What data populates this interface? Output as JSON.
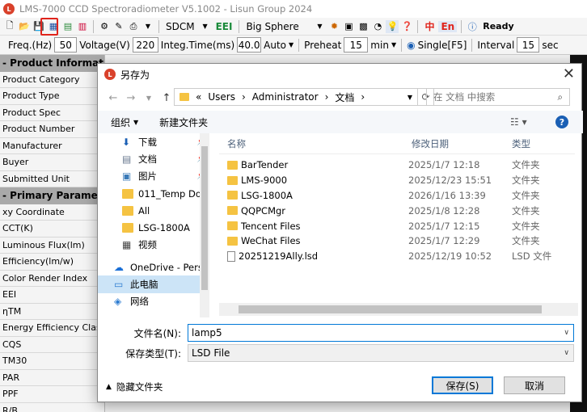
{
  "app": {
    "title": "LMS-7000 CCD Spectroradiometer V5.1002 - Lisun Group 2024",
    "icon": "lisun-logo-icon"
  },
  "toolbar1": {
    "mode": "SDCM",
    "eei": "EEI",
    "sphere": "Big Sphere",
    "lang_cn": "中",
    "lang_en": "En",
    "status": "Ready"
  },
  "toolbar2": {
    "freq_label": "Freq.(Hz)",
    "freq_value": "50",
    "voltage_label": "Voltage(V)",
    "voltage_value": "220",
    "integ_label": "Integ.Time(ms)",
    "integ_value": "40.0",
    "auto": "Auto",
    "preheat_label": "Preheat",
    "preheat_value": "15",
    "preheat_unit": "min",
    "single": "Single[F5]",
    "interval_label": "Interval",
    "interval_value": "15",
    "interval_unit": "sec"
  },
  "left_panel": {
    "section1": "- Product Information",
    "items1": [
      "Product Category",
      "Product Type",
      "Product Spec",
      "Product Number",
      "Manufacturer",
      "Buyer",
      "Submitted Unit"
    ],
    "section2": "- Primary Parameters",
    "items2": [
      "xy Coordinate",
      "CCT(K)",
      "Luminous Flux(lm)",
      "Efficiency(lm/w)",
      "Color Render Index",
      "EEI",
      "ηTM",
      "Energy Efficiency Class",
      "CQS",
      "TM30",
      "PAR",
      "PPF",
      "R/B"
    ]
  },
  "dialog": {
    "title": "另存为",
    "breadcrumb": [
      "«",
      "Users",
      "Administrator",
      "文档"
    ],
    "search_placeholder": "在 文档 中搜索",
    "organize": "组织",
    "new_folder": "新建文件夹",
    "nav_items": [
      {
        "label": "下载",
        "icon": "download-icon",
        "pinned": true
      },
      {
        "label": "文档",
        "icon": "document-icon",
        "pinned": true
      },
      {
        "label": "图片",
        "icon": "picture-icon",
        "pinned": true
      },
      {
        "label": "011_Temp Doc",
        "icon": "folder-icon",
        "pinned": false
      },
      {
        "label": "All",
        "icon": "folder-icon",
        "pinned": false
      },
      {
        "label": "LSG-1800A",
        "icon": "folder-icon",
        "pinned": false
      },
      {
        "label": "视频",
        "icon": "video-icon",
        "pinned": false
      },
      {
        "label": "OneDrive - Pers",
        "icon": "cloud-icon",
        "pinned": false
      },
      {
        "label": "此电脑",
        "icon": "computer-icon",
        "pinned": false
      },
      {
        "label": "网络",
        "icon": "network-icon",
        "pinned": false
      }
    ],
    "columns": {
      "name": "名称",
      "date": "修改日期",
      "type": "类型"
    },
    "files": [
      {
        "name": "BarTender",
        "date": "2025/1/7 12:18",
        "type": "文件夹",
        "icon": "folder-icon"
      },
      {
        "name": "LMS-9000",
        "date": "2025/12/23 15:51",
        "type": "文件夹",
        "icon": "folder-icon"
      },
      {
        "name": "LSG-1800A",
        "date": "2026/1/16 13:39",
        "type": "文件夹",
        "icon": "folder-icon"
      },
      {
        "name": "QQPCMgr",
        "date": "2025/1/8 12:28",
        "type": "文件夹",
        "icon": "folder-icon"
      },
      {
        "name": "Tencent Files",
        "date": "2025/1/7 12:15",
        "type": "文件夹",
        "icon": "folder-icon"
      },
      {
        "name": "WeChat Files",
        "date": "2025/1/7 12:29",
        "type": "文件夹",
        "icon": "folder-icon"
      },
      {
        "name": "20251219Ally.lsd",
        "date": "2025/12/19 10:52",
        "type": "LSD 文件",
        "icon": "file-icon"
      }
    ],
    "filename_label": "文件名(N):",
    "filename_value": "lamp5",
    "filetype_label": "保存类型(T):",
    "filetype_value": "LSD File",
    "hide_folders": "隐藏文件夹",
    "save": "保存(S)",
    "cancel": "取消"
  },
  "colors": {
    "accent": "#0078d7",
    "highlight": "#e0241c",
    "folder": "#f5c342"
  }
}
